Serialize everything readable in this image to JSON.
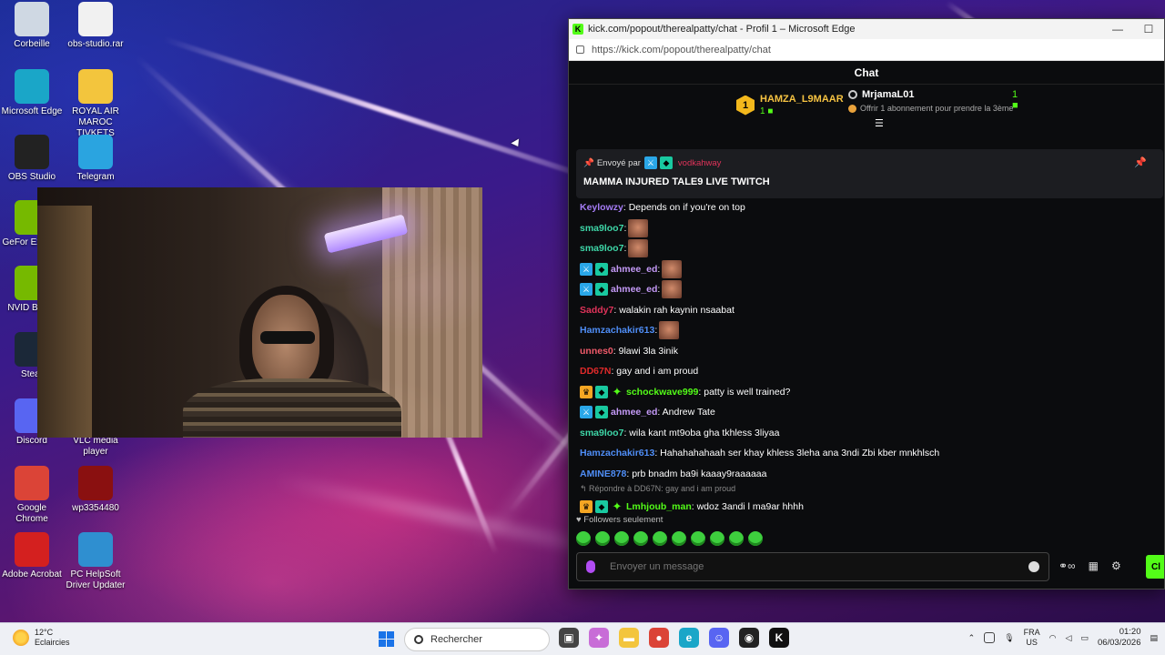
{
  "desktop": {
    "icons": [
      {
        "label": "Corbeille",
        "icon": "recycle-bin-icon",
        "color": "#cfd8e3"
      },
      {
        "label": "obs-studio.rar",
        "icon": "file-icon",
        "color": "#f1f1f1"
      },
      {
        "label": "Microsoft Edge",
        "icon": "edge-icon",
        "color": "#1aa6c8"
      },
      {
        "label": "ROYAL AIR MAROC TIVKETS",
        "icon": "folder-icon",
        "color": "#f3c53d"
      },
      {
        "label": "OBS Studio",
        "icon": "obs-icon",
        "color": "#222222"
      },
      {
        "label": "Telegram",
        "icon": "telegram-icon",
        "color": "#2aa4e0"
      },
      {
        "label": "GeFor Experie",
        "icon": "nvidia-icon",
        "color": "#76b900"
      },
      {
        "label": "NVID Broad",
        "icon": "nvidia-broadcast-icon",
        "color": "#76b900"
      },
      {
        "label": "Stear",
        "icon": "steam-icon",
        "color": "#1b2838"
      },
      {
        "label": "Discord",
        "icon": "discord-icon",
        "color": "#5865f2"
      },
      {
        "label": "VLC media player",
        "icon": "vlc-icon",
        "color": "#f08a00"
      },
      {
        "label": "Google Chrome",
        "icon": "chrome-icon",
        "color": "#db4437"
      },
      {
        "label": "wp3354480",
        "icon": "image-icon",
        "color": "#8a1010"
      },
      {
        "label": "Adobe Acrobat",
        "icon": "acrobat-icon",
        "color": "#d4201f"
      },
      {
        "label": "PC HelpSoft Driver Updater",
        "icon": "driver-updater-icon",
        "color": "#2f8fd0"
      }
    ]
  },
  "browser": {
    "title": "kick.com/popout/therealpatty/chat - Profil 1 – Microsoft Edge",
    "url": "https://kick.com/popout/therealpatty/chat",
    "min_glyph": "—",
    "max_glyph": "☐"
  },
  "chat": {
    "header": "Chat",
    "leaderboard": {
      "first_rank": "1",
      "first_name": "HAMZA_L9MAAR",
      "first_count": "1",
      "second_name": "MrjamaL01",
      "second_count": "1",
      "cta": "Offrir 1 abonnement pour prendre la 3ème"
    },
    "pinned": {
      "by_label": "Envoyé par",
      "by_user": "vodkahway",
      "message": "MAMMA INJURED TALE9 LIVE TWITCH"
    },
    "messages": [
      {
        "badges": [],
        "user": "Keylowzy",
        "color": "#a57cf5",
        "text": ": Depends on if you're on top",
        "emote": false
      },
      {
        "badges": [],
        "user": "sma9loo7",
        "color": "#3ed6a7",
        "text": ":",
        "emote": true
      },
      {
        "badges": [],
        "user": "sma9loo7",
        "color": "#3ed6a7",
        "text": ":",
        "emote": true
      },
      {
        "badges": [
          "mod",
          "vip"
        ],
        "user": "ahmee_ed",
        "color": "#c49af7",
        "text": ":",
        "emote": true
      },
      {
        "badges": [
          "mod",
          "vip"
        ],
        "user": "ahmee_ed",
        "color": "#c49af7",
        "text": ":",
        "emote": true
      },
      {
        "badges": [],
        "user": "Saddy7",
        "color": "#e0335a",
        "text": ": walakin rah kaynin nsaabat",
        "emote": false
      },
      {
        "badges": [],
        "user": "Hamzachakir613",
        "color": "#4f8ef7",
        "text": ":",
        "emote": true
      },
      {
        "badges": [],
        "user": "unnes0",
        "color": "#f05a6a",
        "text": ": 9lawi 3la 3inik",
        "emote": false
      },
      {
        "badges": [],
        "user": "DD67N",
        "color": "#e02a2a",
        "text": ": gay and i am proud",
        "emote": false
      },
      {
        "badges": [
          "crown",
          "vip",
          "og"
        ],
        "user": "schockwave999",
        "color": "#53fc18",
        "text": ": patty is well trained?",
        "emote": false
      },
      {
        "badges": [
          "mod",
          "vip"
        ],
        "user": "ahmee_ed",
        "color": "#c49af7",
        "text": ": Andrew Tate",
        "emote": false
      },
      {
        "badges": [],
        "user": "sma9loo7",
        "color": "#3ed6a7",
        "text": ": wila kant mt9oba gha tkhless 3liyaa",
        "emote": false
      },
      {
        "badges": [],
        "user": "Hamzachakir613",
        "color": "#4f8ef7",
        "text": ": Hahahahahaah ser khay khless 3leha ana 3ndi Zbi kber mnkhlsch",
        "emote": false
      },
      {
        "badges": [],
        "user": "AMINE878",
        "color": "#4f8ef7",
        "text": ": prb bnadm ba9i kaaay9raaaaaa",
        "emote": false
      }
    ],
    "reply_context": "Répondre à DD67N: gay and i am proud",
    "last_message": {
      "badges": [
        "crown",
        "vip",
        "og"
      ],
      "user": "Lmhjoub_man",
      "color": "#53fc18",
      "text": ": wdoz 3andi l ma9ar hhhh"
    },
    "followers_only": "Followers seulement",
    "input_placeholder": "Envoyer un message",
    "send_label": "Cl"
  },
  "taskbar": {
    "weather_temp": "12°C",
    "weather_desc": "Eclaircies",
    "search_placeholder": "Rechercher",
    "lang_1": "FRA",
    "lang_2": "US",
    "time": "01:20",
    "date": "06/03/2026",
    "apps": [
      {
        "name": "taskview-icon",
        "color": "#444444",
        "glyph": "▣"
      },
      {
        "name": "copilot-icon",
        "color": "#c86dd7",
        "glyph": "✦"
      },
      {
        "name": "file-explorer-icon",
        "color": "#f3c53d",
        "glyph": "▬"
      },
      {
        "name": "chrome-icon",
        "color": "#db4437",
        "glyph": "●"
      },
      {
        "name": "edge-icon",
        "color": "#1aa6c8",
        "glyph": "e"
      },
      {
        "name": "discord-icon",
        "color": "#5865f2",
        "glyph": "☺"
      },
      {
        "name": "obs-icon",
        "color": "#222222",
        "glyph": "◉"
      },
      {
        "name": "kick-icon",
        "color": "#111111",
        "glyph": "K"
      }
    ]
  }
}
